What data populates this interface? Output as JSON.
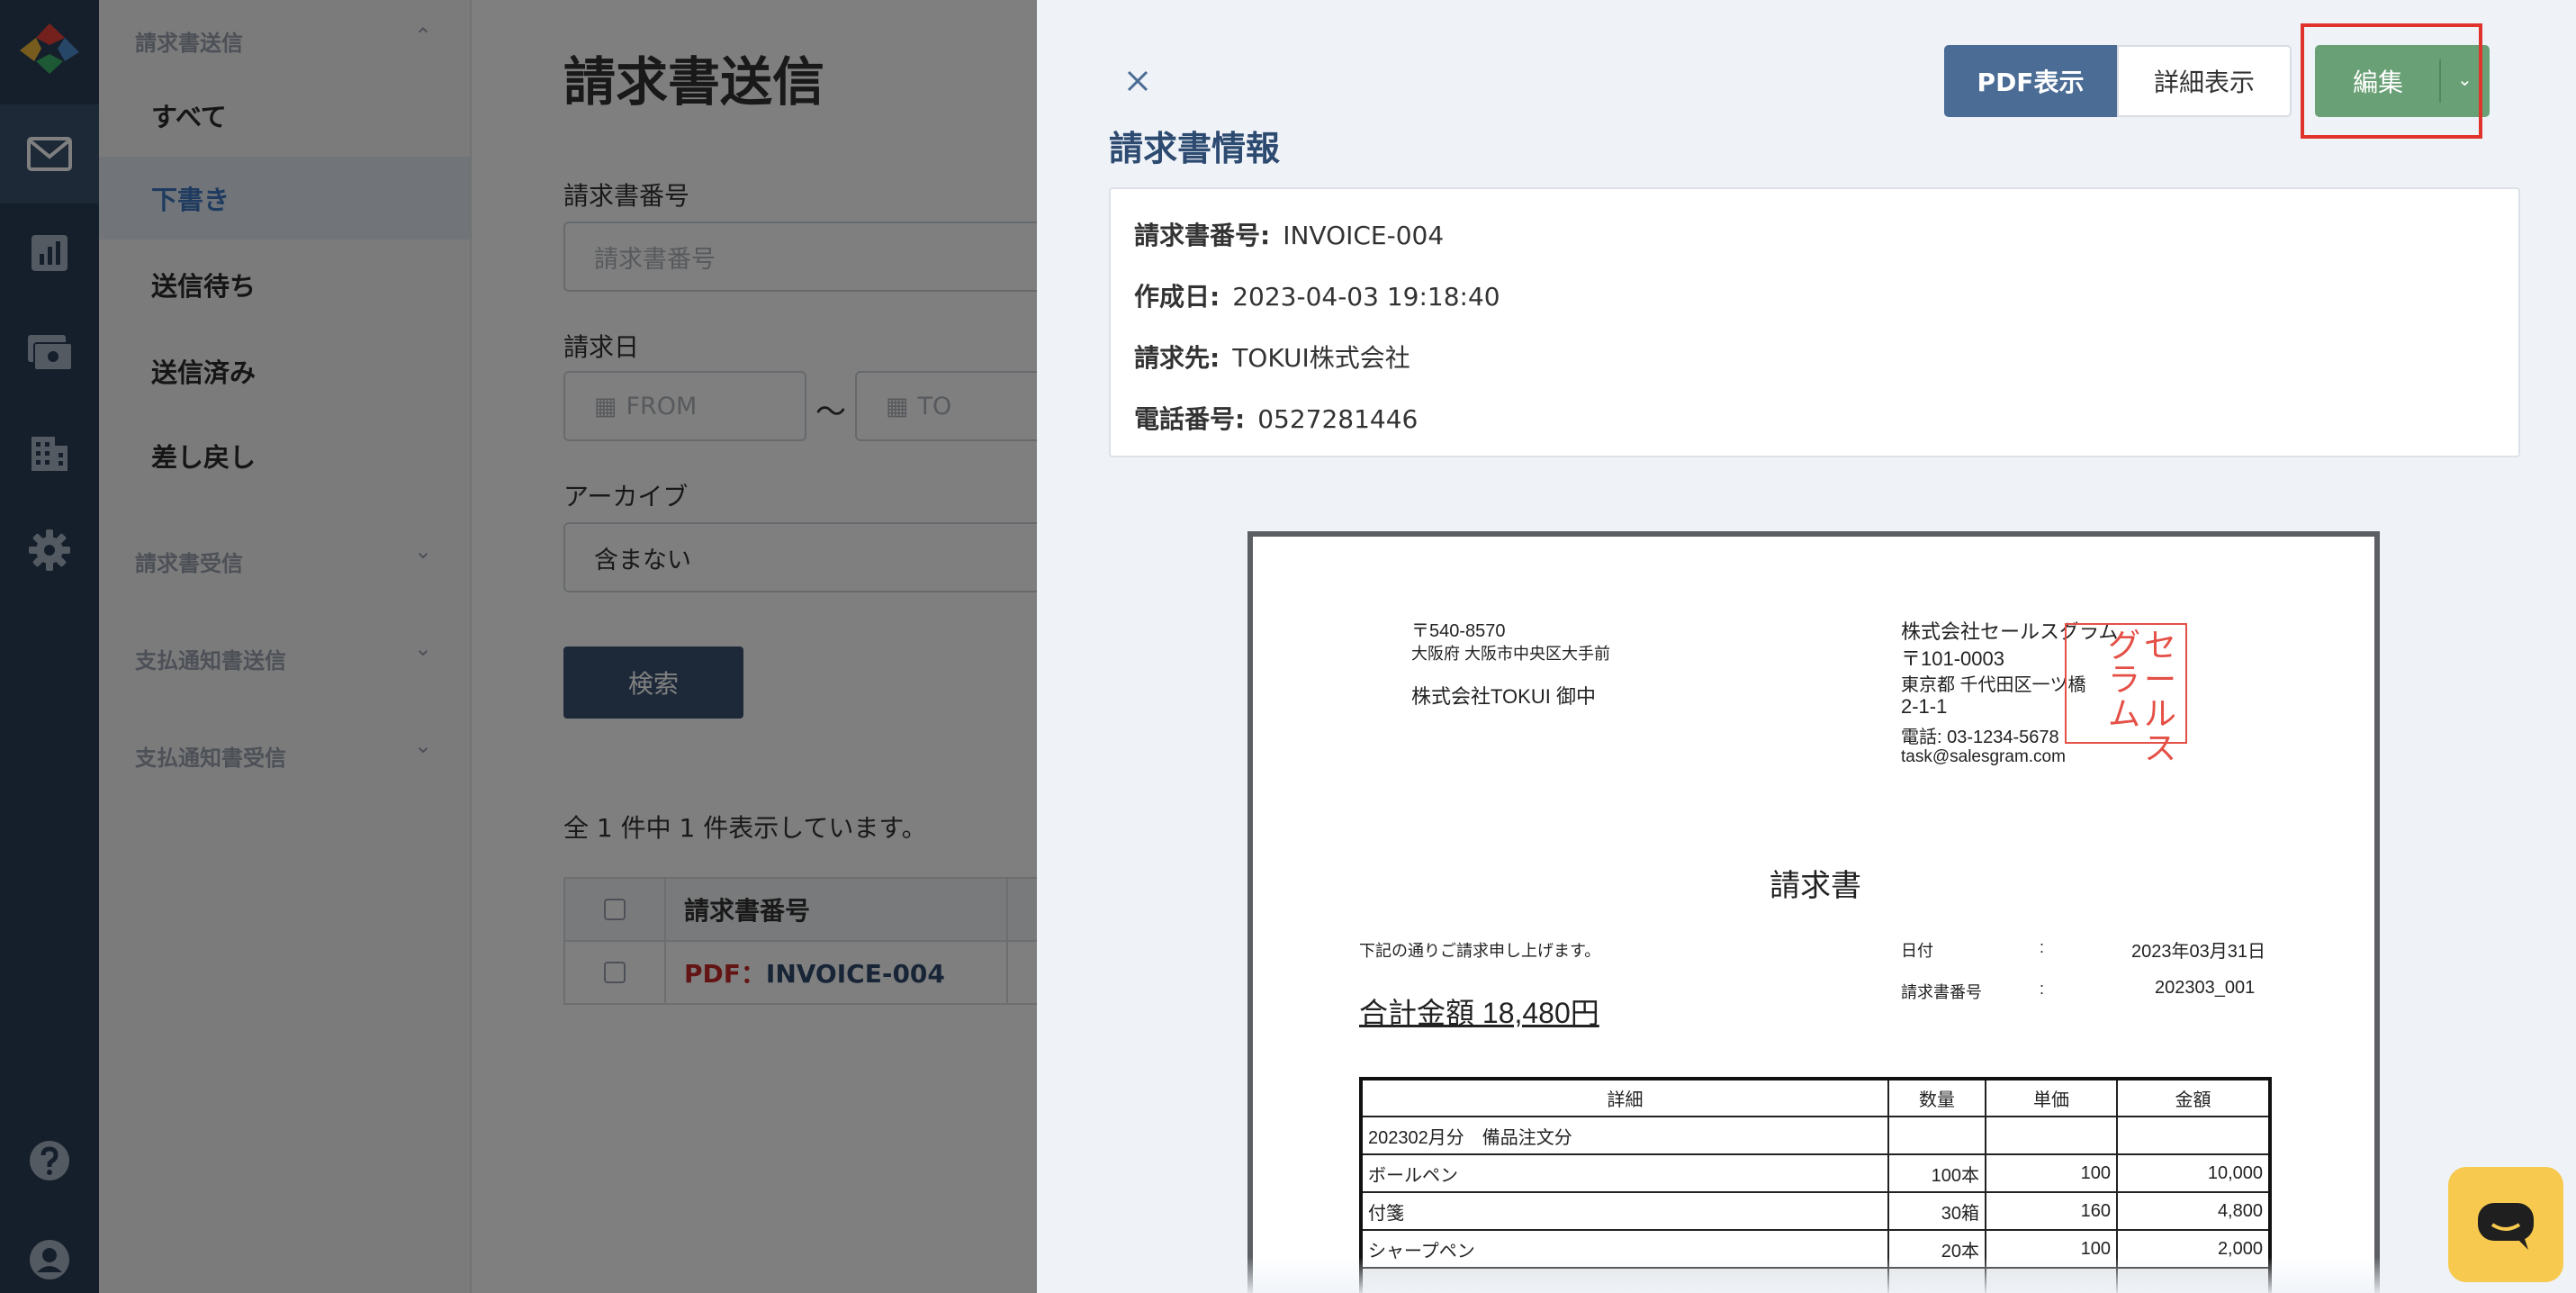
{
  "sidebar": {
    "groups": {
      "invoice_send": "請求書送信",
      "invoice_receive": "請求書受信",
      "payment_notice_send": "支払通知書送信",
      "payment_notice_receive": "支払通知書受信"
    },
    "items": [
      {
        "label": "すべて"
      },
      {
        "label": "下書き"
      },
      {
        "label": "送信待ち"
      },
      {
        "label": "送信済み"
      },
      {
        "label": "差し戻し"
      }
    ]
  },
  "main": {
    "title": "請求書送信",
    "invoice_no_label": "請求書番号",
    "invoice_no_placeholder": "請求書番号",
    "date_label": "請求日",
    "date_from_placeholder": "FROM",
    "date_to_placeholder": "TO",
    "date_sep": "〜",
    "archive_label": "アーカイブ",
    "archive_value": "含まない",
    "search_button": "検索",
    "result_count": "全 1 件中 1 件表示しています。",
    "table": {
      "col_invoice_no": "請求書番号",
      "row_pdf_prefix": "PDF：",
      "row_invoice_no": "INVOICE-004"
    }
  },
  "drawer": {
    "buttons": {
      "pdf_view": "PDF表示",
      "detail_view": "詳細表示",
      "edit": "編集"
    },
    "section_title": "請求書情報",
    "info": {
      "invoice_no_label": "請求書番号:",
      "invoice_no": "INVOICE-004",
      "created_label": "作成日:",
      "created": "2023-04-03 19:18:40",
      "billing_to_label": "請求先:",
      "billing_to": "TOKUI株式会社",
      "phone_label": "電話番号:",
      "phone": "0527281446"
    }
  },
  "invoice_doc": {
    "to_postal": "〒540-8570",
    "to_address": "大阪府 大阪市中央区大手前",
    "to_company": "株式会社TOKUI 御中",
    "from_company": "株式会社セールスグラム",
    "from_postal": "〒101-0003",
    "from_address1": "東京都 千代田区一ツ橋",
    "from_address2": "2-1-1",
    "from_phone": "電話: 03-1234-5678",
    "from_email": "task@salesgram.com",
    "stamp_cols": [
      "セールス",
      "グラム"
    ],
    "title": "請求書",
    "greeting": "下記の通りご請求申し上げます。",
    "date_label": "日付",
    "date_value": "2023年03月31日",
    "number_label": "請求書番号",
    "number_value": "202303_001",
    "colon": ":",
    "total": "合計金額 18,480円",
    "columns": [
      "詳細",
      "数量",
      "単価",
      "金額"
    ],
    "rows": [
      {
        "detail": "202302月分　備品注文分",
        "qty": "",
        "unit": "",
        "amount": ""
      },
      {
        "detail": "ボールペン",
        "qty": "100本",
        "unit": "100",
        "amount": "10,000"
      },
      {
        "detail": "付箋",
        "qty": "30箱",
        "unit": "160",
        "amount": "4,800"
      },
      {
        "detail": "シャープペン",
        "qty": "20本",
        "unit": "100",
        "amount": "2,000"
      }
    ]
  },
  "colors": {
    "rail": "#2b3e57",
    "primary": "#4b6c95",
    "edit_green": "#69a075",
    "highlight_red": "#e0332c",
    "chat_yellow": "#f7c94e"
  }
}
